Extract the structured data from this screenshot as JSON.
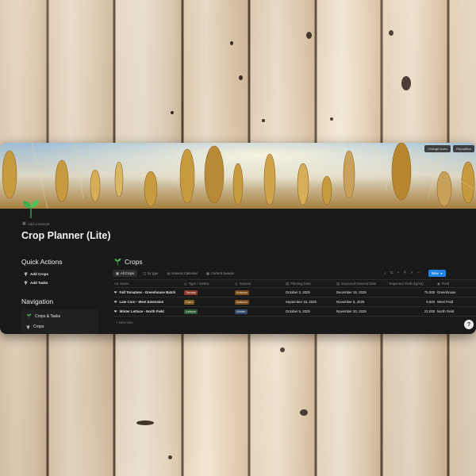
{
  "cover": {
    "change_cover_label": "Change cover",
    "reposition_label": "Reposition"
  },
  "page": {
    "add_comment": "Add comment",
    "title": "Crop Planner (Lite)"
  },
  "quick_actions": {
    "title": "Quick Actions",
    "buttons": [
      {
        "label": "Add Crops",
        "icon": "plant-icon"
      },
      {
        "label": "Add Tasks",
        "icon": "plant-icon"
      }
    ]
  },
  "navigation": {
    "title": "Navigation",
    "items": [
      {
        "label": "Crops & Tasks",
        "icon": "sprout-icon"
      },
      {
        "label": "Crops",
        "icon": "plant-icon"
      }
    ]
  },
  "database": {
    "title": "Crops",
    "views": [
      "All Crops",
      "by type",
      "Harvest Calendar",
      "Current Season"
    ],
    "new_label": "New",
    "new_item_label": "+ New item",
    "columns": [
      "Name",
      "Type / Variety",
      "Season",
      "Planting Date",
      "Expected Harvest Date",
      "Expected Yield (kg/ha)",
      "Field"
    ],
    "rows": [
      {
        "name": "Fall Tomatoes - Greenhouse Batch",
        "type": "Tomato",
        "season": "Autumn",
        "planting": "October 3, 2025",
        "harvest": "December 15, 2025",
        "yield": "75,000",
        "field": "Greenhouse"
      },
      {
        "name": "Late Corn - West Extension",
        "type": "Corn",
        "season": "Autumn",
        "planting": "September 15, 2025",
        "harvest": "November 5, 2025",
        "yield": "9,500",
        "field": "West Field"
      },
      {
        "name": "Winter Lettuce - North Field",
        "type": "Lettuce",
        "season": "Winter",
        "planting": "October 5, 2025",
        "harvest": "November 20, 2025",
        "yield": "22,000",
        "field": "North Field"
      }
    ]
  },
  "colors": {
    "tag_tomato": "#8a3b2c",
    "tag_corn": "#7a5a1e",
    "tag_lettuce": "#2c5a34",
    "tag_autumn": "#7a4a1e",
    "tag_winter": "#2c4a6e",
    "accent": "#2383e2",
    "app_background": "#191919"
  }
}
